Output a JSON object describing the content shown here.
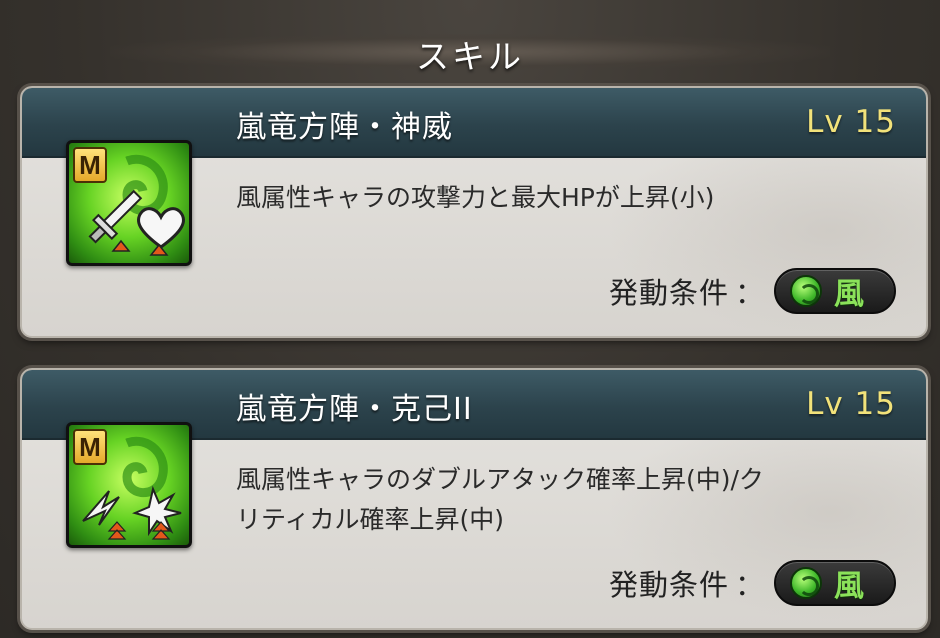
{
  "section": {
    "title": "スキル"
  },
  "skills": [
    {
      "name": "嵐竜方陣・神威",
      "level": "Lv 15",
      "description_lines": [
        "風属性キャラの攻撃力と最大HPが上昇(小)"
      ],
      "condition_label": "発動条件",
      "condition_colon": "：",
      "element": "風",
      "badge": "M",
      "icon": "sword-and-heart-up-icon"
    },
    {
      "name": "嵐竜方陣・克己II",
      "level": "Lv 15",
      "description_lines": [
        "風属性キャラのダブルアタック確率上昇(中)/ク",
        "リティカル確率上昇(中)"
      ],
      "condition_label": "発動条件",
      "condition_colon": "：",
      "element": "風",
      "badge": "M",
      "icon": "double-attack-critical-up-icon"
    }
  ],
  "colors": {
    "title_bar": "#2c434c",
    "level_text": "#f2e27a",
    "element_wind": "#8be25a",
    "card_bg": "#dedcd8"
  }
}
